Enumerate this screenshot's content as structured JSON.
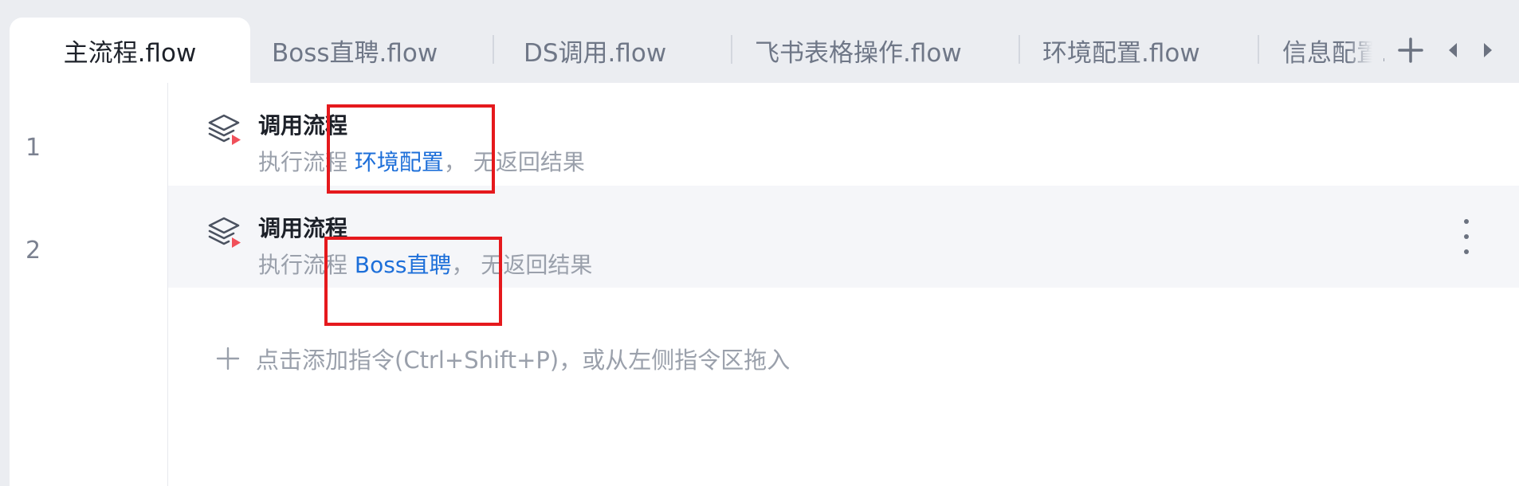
{
  "tabs": [
    {
      "label": "主流程.flow",
      "active": true
    },
    {
      "label": "Boss直聘.flow",
      "active": false
    },
    {
      "label": "DS调用.flow",
      "active": false
    },
    {
      "label": "飞书表格操作.flow",
      "active": false
    },
    {
      "label": "环境配置.flow",
      "active": false
    },
    {
      "label": "信息配置.flow",
      "active": false
    }
  ],
  "tab_controls": {
    "add": "add-tab",
    "prev": "scroll-left",
    "next": "scroll-right"
  },
  "rows": [
    {
      "line": "1",
      "title": "调用流程",
      "desc_prefix": "执行流程 ",
      "flow_name": "环境配置",
      "desc_suffix": "，  无返回结果"
    },
    {
      "line": "2",
      "title": "调用流程",
      "desc_prefix": "执行流程 ",
      "flow_name": "Boss直聘",
      "desc_suffix": "，  无返回结果"
    }
  ],
  "add_instruction": "点击添加指令(Ctrl+Shift+P)，或从左侧指令区拖入",
  "colors": {
    "accent": "#1d6fd9",
    "highlight_box": "#e5191d",
    "icon_play": "#f0505a"
  }
}
